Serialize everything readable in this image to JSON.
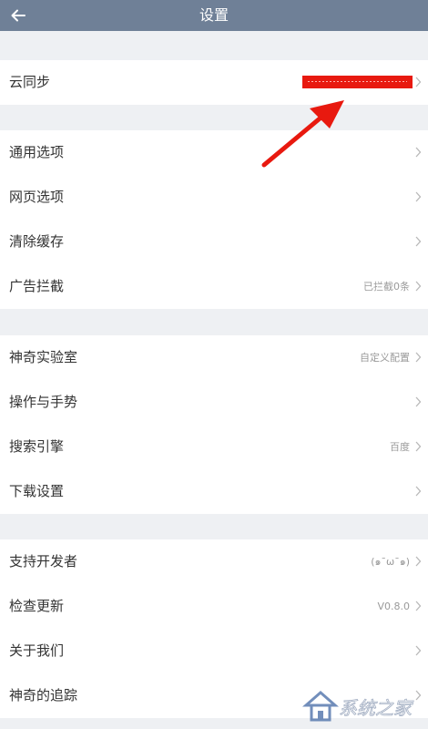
{
  "header": {
    "title": "设置",
    "back_icon": "arrow-left-icon"
  },
  "sections": [
    {
      "items": [
        {
          "label": "云同步",
          "value": ""
        }
      ]
    },
    {
      "items": [
        {
          "label": "通用选项",
          "value": ""
        },
        {
          "label": "网页选项",
          "value": ""
        },
        {
          "label": "清除缓存",
          "value": ""
        },
        {
          "label": "广告拦截",
          "value": "已拦截0条"
        }
      ]
    },
    {
      "items": [
        {
          "label": "神奇实验室",
          "value": "自定义配置"
        },
        {
          "label": "操作与手势",
          "value": ""
        },
        {
          "label": "搜索引擎",
          "value": "百度"
        },
        {
          "label": "下载设置",
          "value": ""
        }
      ]
    },
    {
      "items": [
        {
          "label": "支持开发者",
          "value": "(๑¯ω¯๑)"
        },
        {
          "label": "检查更新",
          "value": "V0.8.0"
        },
        {
          "label": "关于我们",
          "value": ""
        },
        {
          "label": "神奇的追踪",
          "value": ""
        }
      ]
    }
  ],
  "annotation": {
    "redaction_color": "#e8190f",
    "arrow_color": "#e8190f"
  },
  "watermark": {
    "text": "系统之家",
    "logo_icon": "house-logo-icon"
  },
  "colors": {
    "header_bg": "#6f8097",
    "page_bg": "#eef0f3",
    "row_bg": "#ffffff"
  }
}
